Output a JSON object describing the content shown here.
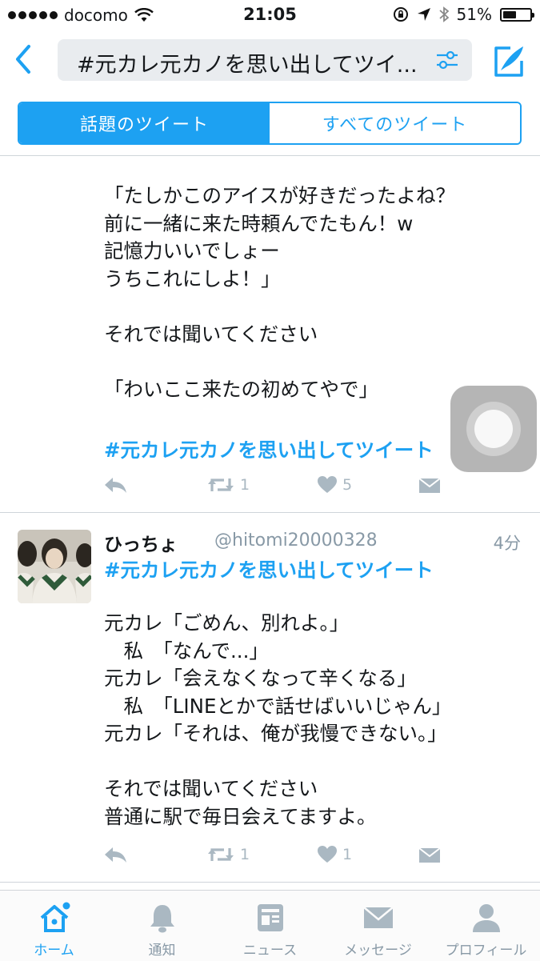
{
  "status_bar": {
    "carrier": "docomo",
    "time": "21:05",
    "battery": "51%",
    "battery_level": 0.51
  },
  "search": {
    "query": "#元カレ元カノを思い出してツイ..."
  },
  "segments": {
    "top": "話題のツイート",
    "all": "すべてのツイート"
  },
  "tweets": [
    {
      "body": "「たしかこのアイスが好きだったよね？\n前に一緒に来た時頼んでたもん！w\n記憶力いいでしょー\nうちこれにしよ！」\n\nそれでは聞いてください\n\n「わいここ来たの初めてやで」",
      "hashtag": "#元カレ元カノを思い出してツイート",
      "retweets": "1",
      "likes": "5"
    },
    {
      "name": "ひっちょ",
      "handle": "@hitomi20000328",
      "time": "4分",
      "hashtag": "#元カレ元カノを思い出してツイート",
      "body": "元カレ「ごめん、別れよ。」\n　私　「なんで...」\n元カレ「会えなくなって辛くなる」\n　私　「LINEとかで話せばいいじゃん」\n元カレ「それは、俺が我慢できない。」\n\nそれでは聞いてください\n普通に駅で毎日会えてますよ。",
      "retweets": "1",
      "likes": "1"
    }
  ],
  "tabbar": [
    {
      "label": "ホーム",
      "icon": "home-icon"
    },
    {
      "label": "通知",
      "icon": "bell-icon"
    },
    {
      "label": "ニュース",
      "icon": "news-icon"
    },
    {
      "label": "メッセージ",
      "icon": "envelope-icon"
    },
    {
      "label": "プロフィール",
      "icon": "person-icon"
    }
  ],
  "colors": {
    "accent": "#1da1f2",
    "muted": "#aab8c2",
    "text": "#14171a"
  }
}
